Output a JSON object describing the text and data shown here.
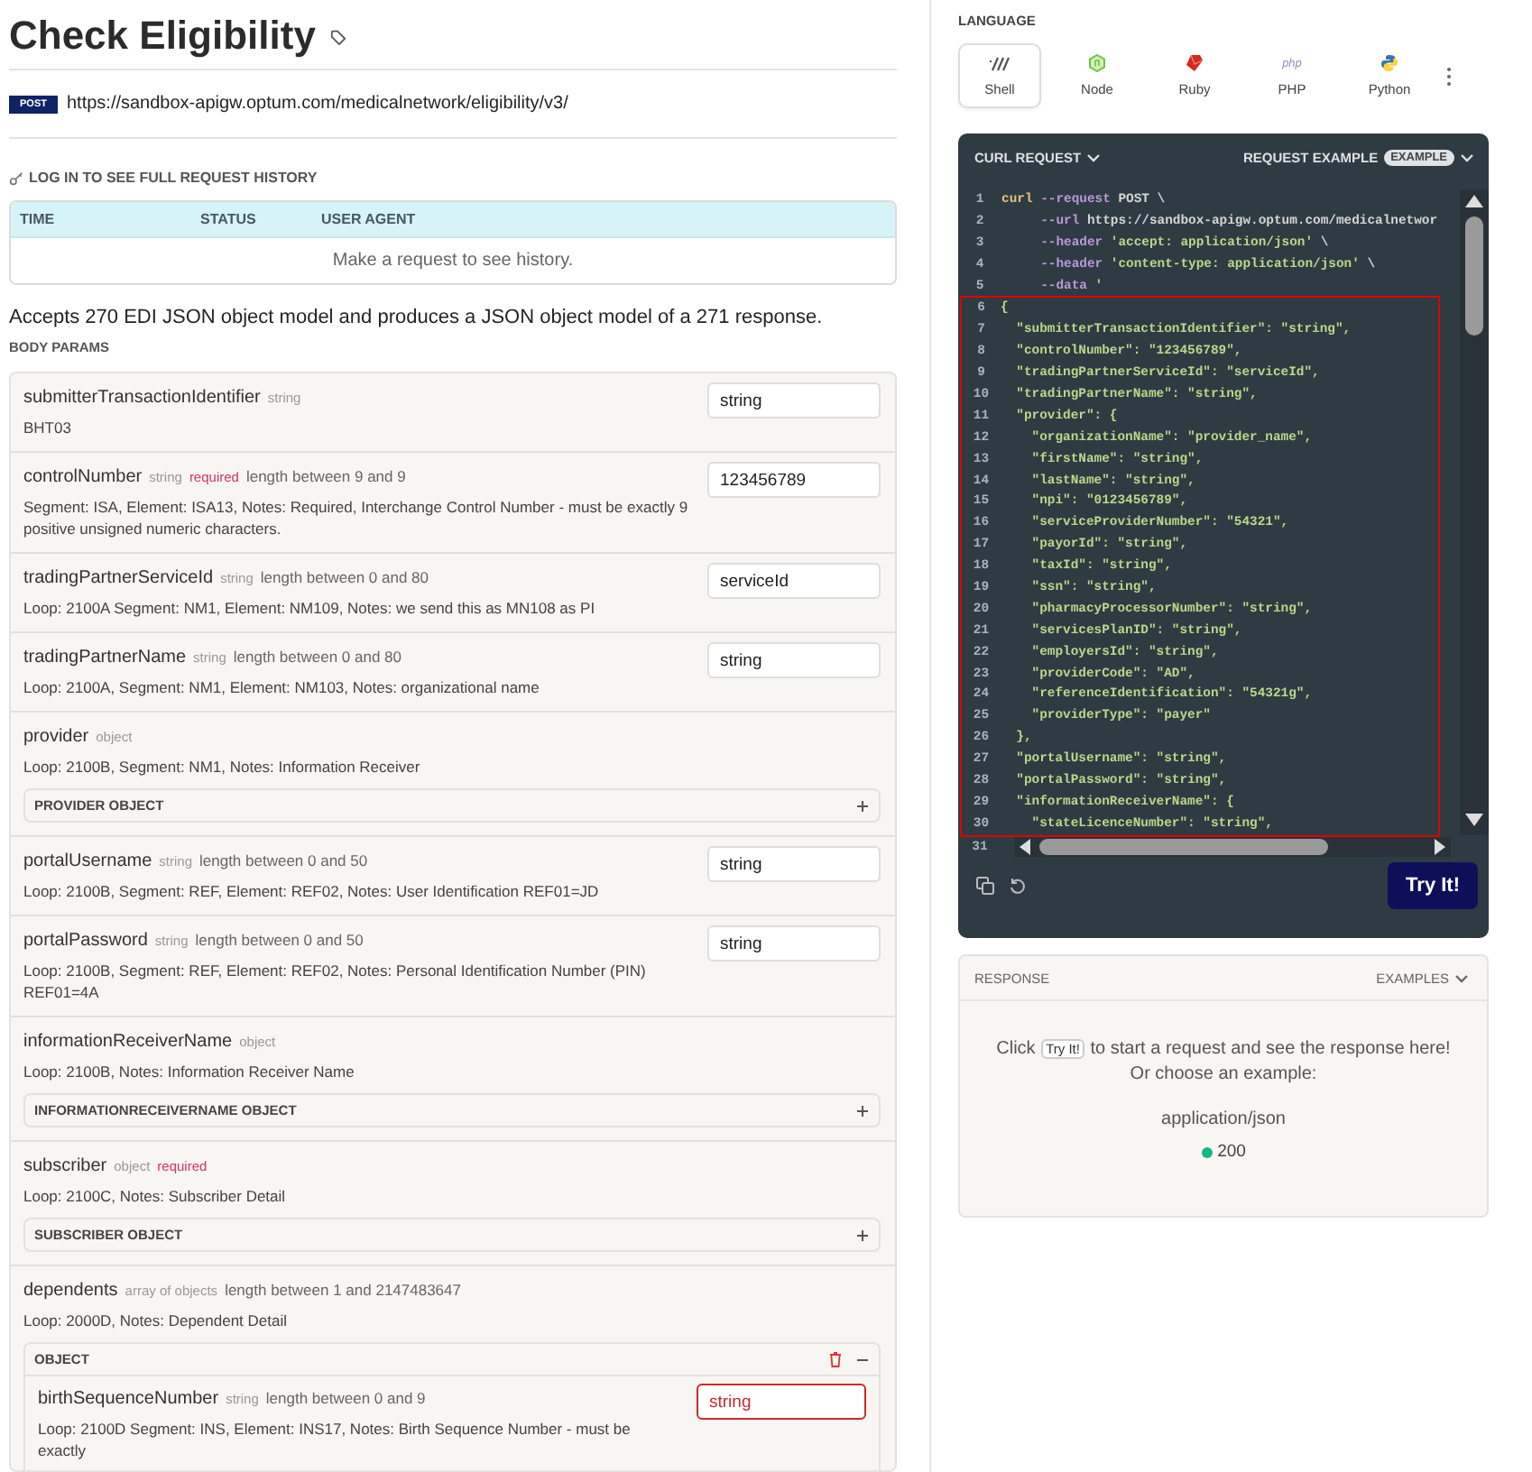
{
  "page": {
    "title": "Check Eligibility",
    "method": "POST",
    "url": "https://sandbox-apigw.optum.com/medicalnetwork/eligibility/v3/",
    "history_login": "LOG IN TO SEE FULL REQUEST HISTORY",
    "history_table": {
      "columns": [
        "TIME",
        "STATUS",
        "USER AGENT"
      ],
      "empty_message": "Make a request to see history."
    },
    "description": "Accepts 270 EDI JSON object model and produces a JSON object model of a 271 response.",
    "body_params_label": "BODY PARAMS"
  },
  "params": [
    {
      "kind": "field",
      "name": "submitterTransactionIdentifier",
      "type": "string",
      "required": false,
      "description": "BHT03",
      "value": "string",
      "invalid": false
    },
    {
      "kind": "field",
      "name": "controlNumber",
      "type": "string",
      "required": true,
      "required_label": "required",
      "constraint": "length between 9 and 9",
      "description": "Segment: ISA, Element: ISA13, Notes: Required, Interchange Control Number - must be exactly 9 positive unsigned numeric characters.",
      "value": "123456789",
      "invalid": false
    },
    {
      "kind": "field",
      "name": "tradingPartnerServiceId",
      "type": "string",
      "required": false,
      "constraint": "length between 0 and 80",
      "description": "Loop: 2100A Segment: NM1, Element: NM109, Notes: we send this as MN108 as PI",
      "value": "serviceId",
      "invalid": false
    },
    {
      "kind": "field",
      "name": "tradingPartnerName",
      "type": "string",
      "required": false,
      "constraint": "length between 0 and 80",
      "description": "Loop: 2100A, Segment: NM1, Element: NM103, Notes: organizational name",
      "value": "string",
      "invalid": false
    },
    {
      "kind": "object",
      "name": "provider",
      "type": "object",
      "required": false,
      "description": "Loop: 2100B, Segment: NM1, Notes: Information Receiver",
      "object_label": "PROVIDER OBJECT",
      "expanded": false
    },
    {
      "kind": "field",
      "name": "portalUsername",
      "type": "string",
      "required": false,
      "constraint": "length between 0 and 50",
      "description": "Loop: 2100B, Segment: REF, Element: REF02, Notes: User Identification REF01=JD",
      "value": "string",
      "invalid": false
    },
    {
      "kind": "field",
      "name": "portalPassword",
      "type": "string",
      "required": false,
      "constraint": "length between 0 and 50",
      "description": "Loop: 2100B, Segment: REF, Element: REF02, Notes: Personal Identification Number (PIN) REF01=4A",
      "value": "string",
      "invalid": false
    },
    {
      "kind": "object",
      "name": "informationReceiverName",
      "type": "object",
      "required": false,
      "description": "Loop: 2100B, Notes: Information Receiver Name",
      "object_label": "INFORMATIONRECEIVERNAME OBJECT",
      "expanded": false
    },
    {
      "kind": "object",
      "name": "subscriber",
      "type": "object",
      "required": true,
      "required_label": "required",
      "description": "Loop: 2100C, Notes: Subscriber Detail",
      "object_label": "SUBSCRIBER OBJECT",
      "expanded": false
    },
    {
      "kind": "object",
      "name": "dependents",
      "type": "array of objects",
      "required": false,
      "constraint": "length between 1 and 2147483647",
      "description": "Loop: 2000D, Notes: Dependent Detail",
      "object_label": "OBJECT",
      "expanded": true,
      "children": [
        {
          "kind": "field",
          "name": "birthSequenceNumber",
          "type": "string",
          "required": false,
          "constraint": "length between 0 and 9",
          "description": "Loop: 2100D Segment: INS, Element: INS17, Notes: Birth Sequence Number - must be exactly",
          "value": "string",
          "invalid": true
        }
      ]
    }
  ],
  "language": {
    "label": "LANGUAGE",
    "options": [
      {
        "kind": "shell",
        "label": "Shell",
        "selected": true
      },
      {
        "kind": "node",
        "label": "Node",
        "selected": false
      },
      {
        "kind": "ruby",
        "label": "Ruby",
        "selected": false
      },
      {
        "kind": "php",
        "logo_text": "php",
        "label": "PHP",
        "selected": false
      },
      {
        "kind": "python",
        "label": "Python",
        "selected": false
      }
    ]
  },
  "request": {
    "title": "CURL REQUEST",
    "example_label": "REQUEST EXAMPLE",
    "example_badge": "EXAMPLE",
    "try_button": "Try It!",
    "lines": [
      {
        "n": "1",
        "highlighted": false,
        "parts": [
          {
            "kind": "command",
            "text": "curl"
          },
          {
            "kind": "flag",
            "text": " --request"
          },
          {
            "kind": "plain",
            "text": " POST \\"
          }
        ]
      },
      {
        "n": "2",
        "highlighted": false,
        "parts": [
          {
            "kind": "flag",
            "text": "     --url"
          },
          {
            "kind": "plain",
            "text": " https://sandbox-apigw.optum.com/medicalnetwor"
          }
        ]
      },
      {
        "n": "3",
        "highlighted": false,
        "parts": [
          {
            "kind": "flag",
            "text": "     --header"
          },
          {
            "kind": "string",
            "text": " 'accept: application/json'"
          },
          {
            "kind": "plain",
            "text": " \\"
          }
        ]
      },
      {
        "n": "4",
        "highlighted": false,
        "parts": [
          {
            "kind": "flag",
            "text": "     --header"
          },
          {
            "kind": "string",
            "text": " 'content-type: application/json'"
          },
          {
            "kind": "plain",
            "text": " \\"
          }
        ]
      },
      {
        "n": "5",
        "highlighted": false,
        "parts": [
          {
            "kind": "flag",
            "text": "     --data"
          },
          {
            "kind": "string",
            "text": " '"
          }
        ]
      },
      {
        "n": "6",
        "highlighted": true,
        "parts": [
          {
            "kind": "string",
            "text": "{"
          }
        ]
      },
      {
        "n": "7",
        "highlighted": true,
        "parts": [
          {
            "kind": "string",
            "text": "  \"submitterTransactionIdentifier\": \"string\","
          }
        ]
      },
      {
        "n": "8",
        "highlighted": true,
        "parts": [
          {
            "kind": "string",
            "text": "  \"controlNumber\": \"123456789\","
          }
        ]
      },
      {
        "n": "9",
        "highlighted": true,
        "parts": [
          {
            "kind": "string",
            "text": "  \"tradingPartnerServiceId\": \"serviceId\","
          }
        ]
      },
      {
        "n": "10",
        "highlighted": true,
        "parts": [
          {
            "kind": "string",
            "text": "  \"tradingPartnerName\": \"string\","
          }
        ]
      },
      {
        "n": "11",
        "highlighted": true,
        "parts": [
          {
            "kind": "string",
            "text": "  \"provider\": {"
          }
        ]
      },
      {
        "n": "12",
        "highlighted": true,
        "parts": [
          {
            "kind": "string",
            "text": "    \"organizationName\": \"provider_name\","
          }
        ]
      },
      {
        "n": "13",
        "highlighted": true,
        "parts": [
          {
            "kind": "string",
            "text": "    \"firstName\": \"string\","
          }
        ]
      },
      {
        "n": "14",
        "highlighted": true,
        "parts": [
          {
            "kind": "string",
            "text": "    \"lastName\": \"string\","
          }
        ]
      },
      {
        "n": "15",
        "highlighted": true,
        "parts": [
          {
            "kind": "string",
            "text": "    \"npi\": \"0123456789\","
          }
        ]
      },
      {
        "n": "16",
        "highlighted": true,
        "parts": [
          {
            "kind": "string",
            "text": "    \"serviceProviderNumber\": \"54321\","
          }
        ]
      },
      {
        "n": "17",
        "highlighted": true,
        "parts": [
          {
            "kind": "string",
            "text": "    \"payorId\": \"string\","
          }
        ]
      },
      {
        "n": "18",
        "highlighted": true,
        "parts": [
          {
            "kind": "string",
            "text": "    \"taxId\": \"string\","
          }
        ]
      },
      {
        "n": "19",
        "highlighted": true,
        "parts": [
          {
            "kind": "string",
            "text": "    \"ssn\": \"string\","
          }
        ]
      },
      {
        "n": "20",
        "highlighted": true,
        "parts": [
          {
            "kind": "string",
            "text": "    \"pharmacyProcessorNumber\": \"string\","
          }
        ]
      },
      {
        "n": "21",
        "highlighted": true,
        "parts": [
          {
            "kind": "string",
            "text": "    \"servicesPlanID\": \"string\","
          }
        ]
      },
      {
        "n": "22",
        "highlighted": true,
        "parts": [
          {
            "kind": "string",
            "text": "    \"employersId\": \"string\","
          }
        ]
      },
      {
        "n": "23",
        "highlighted": true,
        "parts": [
          {
            "kind": "string",
            "text": "    \"providerCode\": \"AD\","
          }
        ]
      },
      {
        "n": "24",
        "highlighted": true,
        "parts": [
          {
            "kind": "string",
            "text": "    \"referenceIdentification\": \"54321g\","
          }
        ]
      },
      {
        "n": "25",
        "highlighted": true,
        "parts": [
          {
            "kind": "string",
            "text": "    \"providerType\": \"payer\""
          }
        ]
      },
      {
        "n": "26",
        "highlighted": true,
        "parts": [
          {
            "kind": "string",
            "text": "  },"
          }
        ]
      },
      {
        "n": "27",
        "highlighted": true,
        "parts": [
          {
            "kind": "string",
            "text": "  \"portalUsername\": \"string\","
          }
        ]
      },
      {
        "n": "28",
        "highlighted": true,
        "parts": [
          {
            "kind": "string",
            "text": "  \"portalPassword\": \"string\","
          }
        ]
      },
      {
        "n": "29",
        "highlighted": true,
        "parts": [
          {
            "kind": "string",
            "text": "  \"informationReceiverName\": {"
          }
        ]
      },
      {
        "n": "30",
        "highlighted": true,
        "parts": [
          {
            "kind": "string",
            "text": "    \"stateLicenceNumber\": \"string\","
          }
        ]
      },
      {
        "n": "31",
        "highlighted": false
      }
    ]
  },
  "response": {
    "title": "RESPONSE",
    "examples_label": "EXAMPLES",
    "message_before": "Click",
    "message_button": "Try It!",
    "message_after": "to start a request and see the response here! Or choose an example:",
    "content_type": "application/json",
    "examples": [
      {
        "code": "200",
        "color": "#12b886"
      }
    ]
  }
}
